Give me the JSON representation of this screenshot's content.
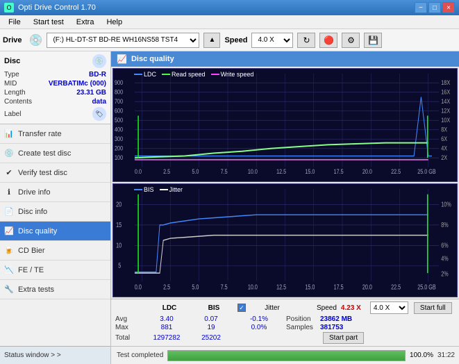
{
  "titlebar": {
    "title": "Opti Drive Control 1.70",
    "min_label": "−",
    "max_label": "□",
    "close_label": "×"
  },
  "menubar": {
    "items": [
      "File",
      "Start test",
      "Extra",
      "Help"
    ]
  },
  "drivebar": {
    "drive_label": "Drive",
    "drive_value": "(F:)  HL-DT-ST BD-RE  WH16NS58 TST4",
    "speed_label": "Speed",
    "speed_value": "4.0 X"
  },
  "disc": {
    "title": "Disc",
    "type_label": "Type",
    "type_value": "BD-R",
    "mid_label": "MID",
    "mid_value": "VERBATIMc (000)",
    "length_label": "Length",
    "length_value": "23.31 GB",
    "contents_label": "Contents",
    "contents_value": "data",
    "label_label": "Label"
  },
  "nav": {
    "items": [
      {
        "id": "transfer-rate",
        "label": "Transfer rate",
        "icon": "📊"
      },
      {
        "id": "create-test-disc",
        "label": "Create test disc",
        "icon": "💿"
      },
      {
        "id": "verify-test-disc",
        "label": "Verify test disc",
        "icon": "✔"
      },
      {
        "id": "drive-info",
        "label": "Drive info",
        "icon": "ℹ"
      },
      {
        "id": "disc-info",
        "label": "Disc info",
        "icon": "📄"
      },
      {
        "id": "disc-quality",
        "label": "Disc quality",
        "icon": "📈",
        "active": true
      },
      {
        "id": "cd-bier",
        "label": "CD Bier",
        "icon": "🍺"
      },
      {
        "id": "fe-te",
        "label": "FE / TE",
        "icon": "📉"
      },
      {
        "id": "extra-tests",
        "label": "Extra tests",
        "icon": "🔧"
      }
    ]
  },
  "status_window": {
    "label": "Status window > >"
  },
  "quality_panel": {
    "title": "Disc quality",
    "legend": {
      "ldc": "LDC",
      "read_speed": "Read speed",
      "write_speed": "Write speed"
    },
    "legend2": {
      "bis": "BIS",
      "jitter": "Jitter"
    },
    "chart1": {
      "y_max": 900,
      "y_labels": [
        "900",
        "800",
        "700",
        "600",
        "500",
        "400",
        "300",
        "200",
        "100"
      ],
      "y_right_labels": [
        "18X",
        "16X",
        "14X",
        "12X",
        "10X",
        "8X",
        "6X",
        "4X",
        "2X"
      ],
      "x_labels": [
        "0.0",
        "2.5",
        "5.0",
        "7.5",
        "10.0",
        "12.5",
        "15.0",
        "17.5",
        "20.0",
        "22.5",
        "25.0 GB"
      ]
    },
    "chart2": {
      "y_max": 20,
      "y_labels": [
        "20",
        "15",
        "10",
        "5"
      ],
      "y_right_labels": [
        "10%",
        "8%",
        "6%",
        "4%",
        "2%"
      ],
      "x_labels": [
        "0.0",
        "2.5",
        "5.0",
        "7.5",
        "10.0",
        "12.5",
        "15.0",
        "17.5",
        "20.0",
        "22.5",
        "25.0 GB"
      ]
    },
    "stats": {
      "col_ldc": "LDC",
      "col_bis": "BIS",
      "jitter_label": "Jitter",
      "speed_label": "Speed",
      "speed_value": "4.23 X",
      "speed_select": "4.0 X",
      "position_label": "Position",
      "position_value": "23862 MB",
      "samples_label": "Samples",
      "samples_value": "381753",
      "avg_label": "Avg",
      "avg_ldc": "3.40",
      "avg_bis": "0.07",
      "avg_jitter": "-0.1%",
      "max_label": "Max",
      "max_ldc": "881",
      "max_bis": "19",
      "max_jitter": "0.0%",
      "total_label": "Total",
      "total_ldc": "1297282",
      "total_bis": "25202",
      "start_full_label": "Start full",
      "start_part_label": "Start part"
    }
  },
  "progressbar": {
    "percent": 100,
    "percent_text": "100.0%",
    "status": "Test completed",
    "time": "31:22"
  }
}
